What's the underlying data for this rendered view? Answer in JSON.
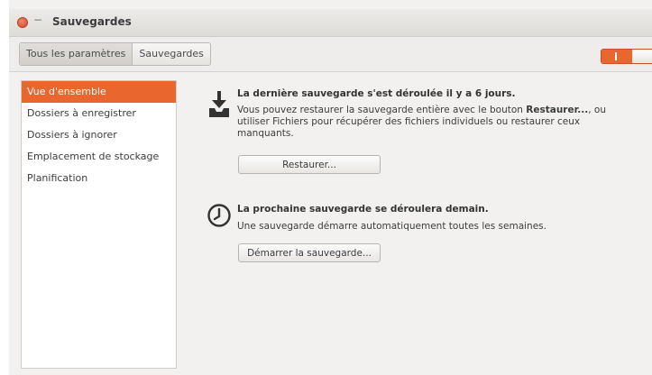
{
  "window": {
    "title": "Sauvegardes",
    "minimize_glyph": "−"
  },
  "toolbar": {
    "breadcrumbs": [
      "Tous les paramètres",
      "Sauvegardes"
    ]
  },
  "sidebar": {
    "items": [
      {
        "label": "Vue d'ensemble",
        "selected": true
      },
      {
        "label": "Dossiers à enregistrer",
        "selected": false
      },
      {
        "label": "Dossiers à ignorer",
        "selected": false
      },
      {
        "label": "Emplacement de stockage",
        "selected": false
      },
      {
        "label": "Planification",
        "selected": false
      }
    ]
  },
  "last_backup": {
    "icon": "download-tray-icon",
    "title": "La dernière sauvegarde s'est déroulée il y a 6 jours.",
    "text_before": "Vous pouvez restaurer la sauvegarde entière avec le bouton ",
    "text_bold": "Restaurer...",
    "text_after": ", ou utiliser Fichiers pour récupérer des fichiers individuels ou restaurer ceux manquants.",
    "button": "Restaurer..."
  },
  "next_backup": {
    "icon": "clock-icon",
    "title": "La prochaine sauvegarde se déroulera demain.",
    "text": "Une sauvegarde démarre automatiquement toutes les semaines.",
    "button": "Démarrer la sauvegarde..."
  },
  "colors": {
    "accent": "#e9662f",
    "window_bg": "#f2f1f0"
  },
  "toggle": {
    "state": "on"
  }
}
